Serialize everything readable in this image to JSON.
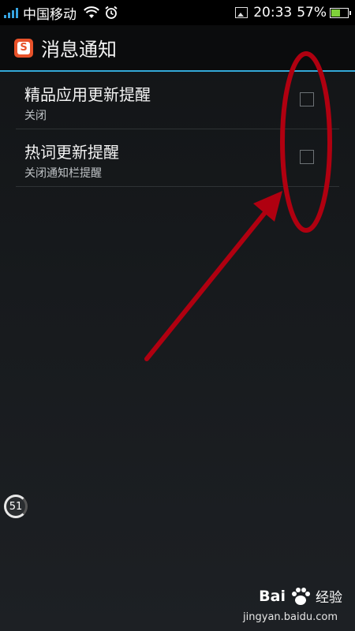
{
  "status_bar": {
    "carrier": "中国移动",
    "time": "20:33",
    "battery_percent": "57%",
    "battery_level": 0.57,
    "icons": [
      "signal-icon",
      "wifi-icon",
      "alarm-icon",
      "image-notification-icon",
      "battery-icon"
    ]
  },
  "action_bar": {
    "title": "消息通知",
    "app_icon": "sogou-input-icon",
    "app_icon_glyph": "S",
    "divider_color": "#33a8d8"
  },
  "settings": [
    {
      "title": "精品应用更新提醒",
      "summary": "关闭",
      "checked": false
    },
    {
      "title": "热词更新提醒",
      "summary": "关闭通知栏提醒",
      "checked": false
    }
  ],
  "annotation": {
    "color": "#b00010",
    "shapes": [
      "ellipse",
      "arrow"
    ]
  },
  "side_badge": {
    "value": "51"
  },
  "watermark": {
    "logo": "Bai",
    "logo_cn": "经验",
    "url": "jingyan.baidu.com"
  }
}
